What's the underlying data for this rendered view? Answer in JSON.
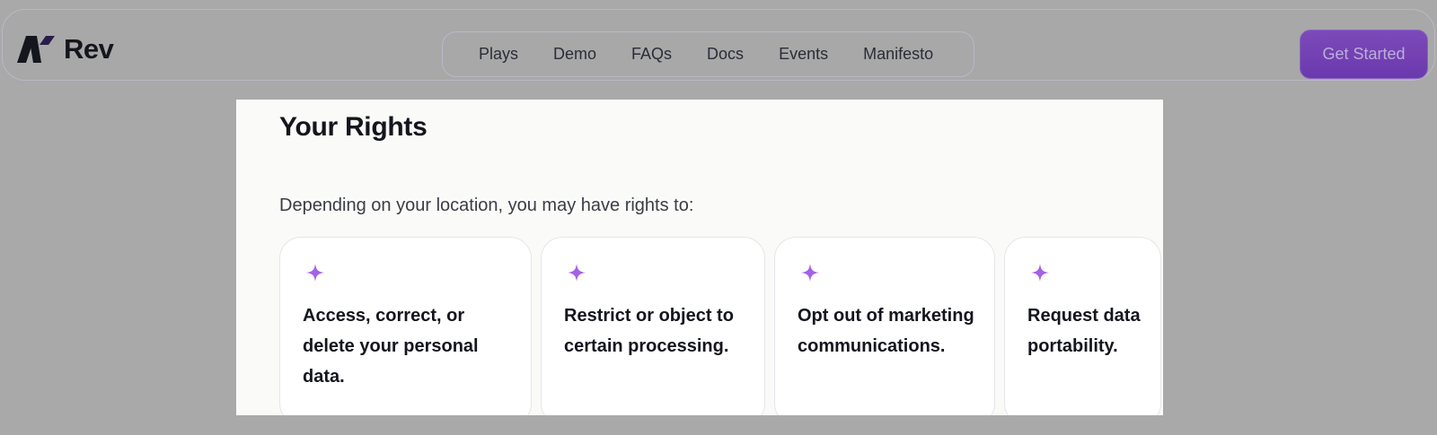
{
  "header": {
    "brand_name": "Rev",
    "nav_items": [
      "Plays",
      "Demo",
      "FAQs",
      "Docs",
      "Events",
      "Manifesto"
    ],
    "cta_label": "Get Started"
  },
  "section": {
    "title": "Your Rights",
    "intro": "Depending on your location, you may have rights to:",
    "cards": [
      {
        "text": "Access, correct, or delete your personal data.",
        "icon": "sparkle-icon"
      },
      {
        "text": "Restrict or object to certain processing.",
        "icon": "sparkle-icon"
      },
      {
        "text": "Opt out of marketing communications.",
        "icon": "sparkle-icon"
      },
      {
        "text": "Request data portability.",
        "icon": "sparkle-icon"
      }
    ]
  },
  "colors": {
    "accent_purple": "#6a39ad",
    "sparkle_purple": "#a560e8",
    "backdrop_gray": "#a9a9a9",
    "panel_bg": "#fafaf8"
  }
}
